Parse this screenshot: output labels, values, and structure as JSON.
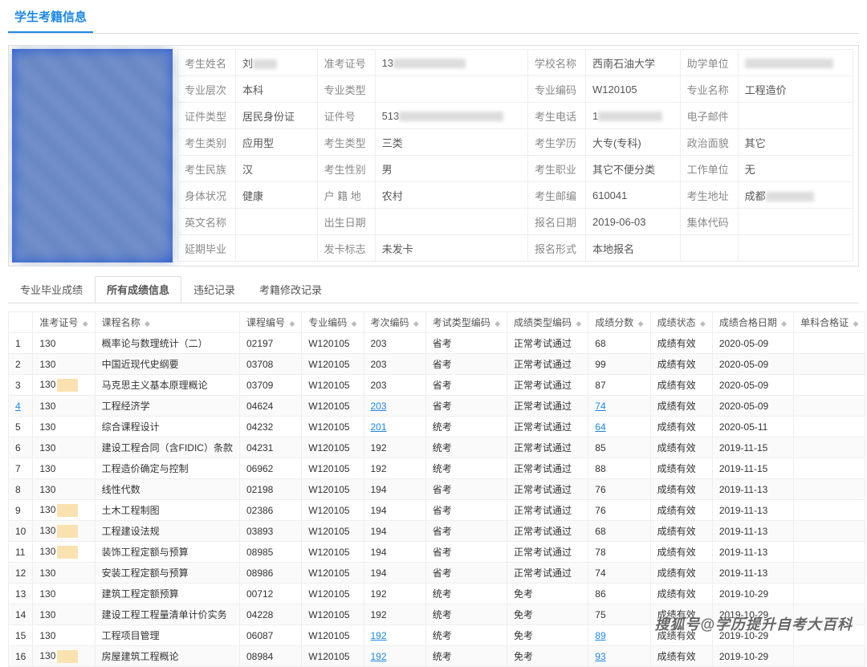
{
  "page_title": "学生考籍信息",
  "info_labels": {
    "name": "考生姓名",
    "exam_no": "准考证号",
    "school": "学校名称",
    "sponsor": "助学单位",
    "level": "专业层次",
    "type": "专业类型",
    "major_code": "专业编码",
    "major_name": "专业名称",
    "id_type": "证件类型",
    "id_no": "证件号",
    "phone": "考生电话",
    "email": "电子邮件",
    "cand_cat": "考生类别",
    "cand_type": "考生类型",
    "edu": "考生学历",
    "politics": "政治面貌",
    "ethnic": "考生民族",
    "gender": "考生性别",
    "job": "考生职业",
    "workplace": "工作单位",
    "health": "身体状况",
    "hukou": "户 籍 地",
    "postcode": "考生邮编",
    "address": "考生地址",
    "en_name": "英文名称",
    "birth": "出生日期",
    "reg_date": "报名日期",
    "group_code": "集体代码",
    "defer": "延期毕业",
    "card_flag": "发卡标志",
    "reg_form": "报名形式"
  },
  "info": {
    "name": "刘",
    "exam_no": "13",
    "school": "西南石油大学",
    "sponsor": "",
    "level": "本科",
    "type": "",
    "major_code": "W120105",
    "major_name": "工程造价",
    "id_type": "居民身份证",
    "id_no": "513",
    "phone": "1",
    "email": "",
    "cand_cat": "应用型",
    "cand_type": "三类",
    "edu": "大专(专科)",
    "politics": "其它",
    "ethnic": "汉",
    "gender": "男",
    "job": "其它不便分类",
    "workplace": "无",
    "health": "健康",
    "hukou": "农村",
    "postcode": "610041",
    "address": "成都",
    "en_name": "",
    "birth": "",
    "reg_date": "2019-06-03",
    "group_code": "",
    "defer": "",
    "card_flag": "未发卡",
    "reg_form": "本地报名"
  },
  "tabs": [
    "专业毕业成绩",
    "所有成绩信息",
    "违纪记录",
    "考籍修改记录"
  ],
  "active_tab": 1,
  "grid_headers": [
    "",
    "准考证号",
    "课程名称",
    "课程编号",
    "专业编码",
    "考次编码",
    "考试类型编码",
    "成绩类型编码",
    "成绩分数",
    "成绩状态",
    "成绩合格日期",
    "单科合格证"
  ],
  "rows": [
    {
      "i": 1,
      "no": "130",
      "y": false,
      "course": "概率论与数理统计（二）",
      "code": "02197",
      "major": "W120105",
      "exam": "203",
      "etype": "省考",
      "rtype": "正常考试通过",
      "score": "68",
      "status": "成绩有效",
      "date": "2020-05-09",
      "link": false
    },
    {
      "i": 2,
      "no": "130",
      "y": false,
      "course": "中国近现代史纲要",
      "code": "03708",
      "major": "W120105",
      "exam": "203",
      "etype": "省考",
      "rtype": "正常考试通过",
      "score": "99",
      "status": "成绩有效",
      "date": "2020-05-09",
      "link": false
    },
    {
      "i": 3,
      "no": "130",
      "y": true,
      "course": "马克思主义基本原理概论",
      "code": "03709",
      "major": "W120105",
      "exam": "203",
      "etype": "省考",
      "rtype": "正常考试通过",
      "score": "87",
      "status": "成绩有效",
      "date": "2020-05-09",
      "link": false
    },
    {
      "i": 4,
      "no": "130",
      "y": false,
      "course": "工程经济学",
      "code": "04624",
      "major": "W120105",
      "exam": "203",
      "etype": "省考",
      "rtype": "正常考试通过",
      "score": "74",
      "status": "成绩有效",
      "date": "2020-05-09",
      "link": true
    },
    {
      "i": 5,
      "no": "130",
      "y": false,
      "course": "综合课程设计",
      "code": "04232",
      "major": "W120105",
      "exam": "201",
      "etype": "统考",
      "rtype": "正常考试通过",
      "score": "64",
      "status": "成绩有效",
      "date": "2020-05-11",
      "link": true
    },
    {
      "i": 6,
      "no": "130",
      "y": false,
      "course": "建设工程合同（含FIDIC）条款",
      "code": "04231",
      "major": "W120105",
      "exam": "192",
      "etype": "统考",
      "rtype": "正常考试通过",
      "score": "85",
      "status": "成绩有效",
      "date": "2019-11-15",
      "link": false
    },
    {
      "i": 7,
      "no": "130",
      "y": false,
      "course": "工程造价确定与控制",
      "code": "06962",
      "major": "W120105",
      "exam": "192",
      "etype": "统考",
      "rtype": "正常考试通过",
      "score": "88",
      "status": "成绩有效",
      "date": "2019-11-15",
      "link": false
    },
    {
      "i": 8,
      "no": "130",
      "y": false,
      "course": "线性代数",
      "code": "02198",
      "major": "W120105",
      "exam": "194",
      "etype": "省考",
      "rtype": "正常考试通过",
      "score": "76",
      "status": "成绩有效",
      "date": "2019-11-13",
      "link": false
    },
    {
      "i": 9,
      "no": "130",
      "y": true,
      "course": "土木工程制图",
      "code": "02386",
      "major": "W120105",
      "exam": "194",
      "etype": "省考",
      "rtype": "正常考试通过",
      "score": "76",
      "status": "成绩有效",
      "date": "2019-11-13",
      "link": false
    },
    {
      "i": 10,
      "no": "130",
      "y": true,
      "course": "工程建设法规",
      "code": "03893",
      "major": "W120105",
      "exam": "194",
      "etype": "省考",
      "rtype": "正常考试通过",
      "score": "68",
      "status": "成绩有效",
      "date": "2019-11-13",
      "link": false
    },
    {
      "i": 11,
      "no": "130",
      "y": true,
      "course": "装饰工程定额与预算",
      "code": "08985",
      "major": "W120105",
      "exam": "194",
      "etype": "省考",
      "rtype": "正常考试通过",
      "score": "78",
      "status": "成绩有效",
      "date": "2019-11-13",
      "link": false
    },
    {
      "i": 12,
      "no": "130",
      "y": false,
      "course": "安装工程定额与预算",
      "code": "08986",
      "major": "W120105",
      "exam": "194",
      "etype": "省考",
      "rtype": "正常考试通过",
      "score": "74",
      "status": "成绩有效",
      "date": "2019-11-13",
      "link": false
    },
    {
      "i": 13,
      "no": "130",
      "y": false,
      "course": "建筑工程定额预算",
      "code": "00712",
      "major": "W120105",
      "exam": "192",
      "etype": "统考",
      "rtype": "免考",
      "score": "86",
      "status": "成绩有效",
      "date": "2019-10-29",
      "link": false
    },
    {
      "i": 14,
      "no": "130",
      "y": false,
      "course": "建设工程工程量清单计价实务",
      "code": "04228",
      "major": "W120105",
      "exam": "192",
      "etype": "统考",
      "rtype": "免考",
      "score": "75",
      "status": "成绩有效",
      "date": "2019-10-29",
      "link": false
    },
    {
      "i": 15,
      "no": "130",
      "y": false,
      "course": "工程项目管理",
      "code": "06087",
      "major": "W120105",
      "exam": "192",
      "etype": "统考",
      "rtype": "免考",
      "score": "89",
      "status": "成绩有效",
      "date": "2019-10-29",
      "link": true
    },
    {
      "i": 16,
      "no": "130",
      "y": true,
      "course": "房屋建筑工程概论",
      "code": "08984",
      "major": "W120105",
      "exam": "192",
      "etype": "统考",
      "rtype": "免考",
      "score": "93",
      "status": "成绩有效",
      "date": "2019-10-29",
      "link": true
    }
  ],
  "watermark": "搜狐号@学历提升自考大百科"
}
